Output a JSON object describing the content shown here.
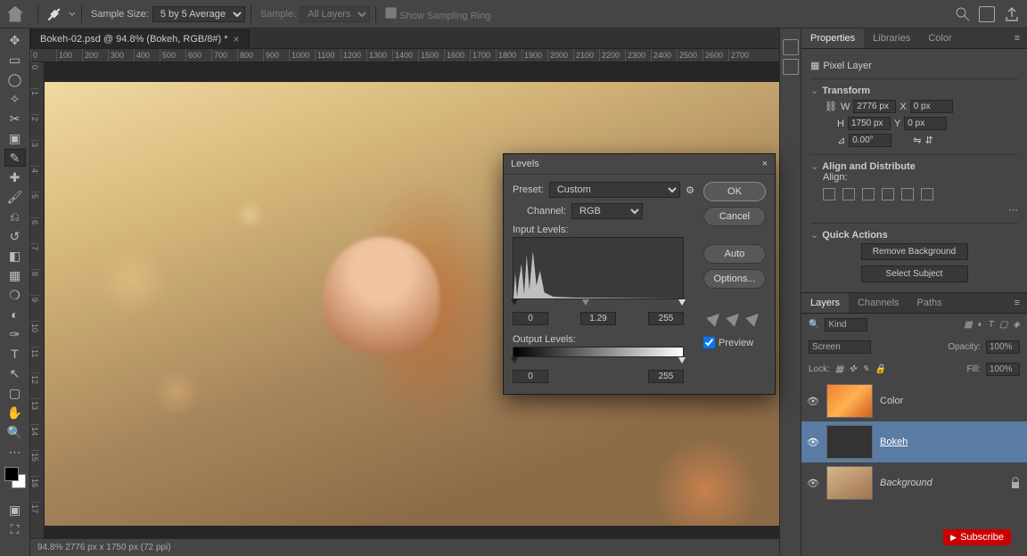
{
  "topbar": {
    "sample_size_label": "Sample Size:",
    "sample_size_value": "5 by 5 Average",
    "sample_label": "Sample:",
    "sample_value": "All Layers",
    "show_ring": "Show Sampling Ring"
  },
  "document": {
    "tab_title": "Bokeh-02.psd @ 94.8% (Bokeh, RGB/8#) *"
  },
  "ruler_marks": [
    "0",
    "100",
    "200",
    "300",
    "400",
    "500",
    "600",
    "700",
    "800",
    "900",
    "1000",
    "1100",
    "1200",
    "1300",
    "1400",
    "1500",
    "1600",
    "1700",
    "1800",
    "1900",
    "2000",
    "2100",
    "2200",
    "2300",
    "2400",
    "2500",
    "2600",
    "2700"
  ],
  "statusbar": "94.8%      2776 px x 1750 px (72 ppi)",
  "properties": {
    "tab_props": "Properties",
    "tab_libs": "Libraries",
    "tab_color": "Color",
    "layer_type": "Pixel Layer",
    "transform": "Transform",
    "w_label": "W",
    "w": "2776 px",
    "x_label": "X",
    "x": "0 px",
    "h_label": "H",
    "h": "1750 px",
    "y_label": "Y",
    "y": "0 px",
    "angle": "0.00°",
    "align": "Align and Distribute",
    "align_label": "Align:",
    "quick": "Quick Actions",
    "remove_bg": "Remove Background",
    "select_subj": "Select Subject"
  },
  "layers": {
    "tab_layers": "Layers",
    "tab_channels": "Channels",
    "tab_paths": "Paths",
    "search_ph": "Kind",
    "blend": "Screen",
    "opacity_label": "Opacity:",
    "opacity": "100%",
    "lock_label": "Lock:",
    "fill_label": "Fill:",
    "fill": "100%",
    "items": [
      {
        "name": "Color"
      },
      {
        "name": "Bokeh"
      },
      {
        "name": "Background"
      }
    ]
  },
  "dialog": {
    "title": "Levels",
    "preset_label": "Preset:",
    "preset": "Custom",
    "channel_label": "Channel:",
    "channel": "RGB",
    "input_label": "Input Levels:",
    "in_black": "0",
    "in_mid": "1.29",
    "in_white": "255",
    "output_label": "Output Levels:",
    "out_black": "0",
    "out_white": "255",
    "ok": "OK",
    "cancel": "Cancel",
    "auto": "Auto",
    "options": "Options...",
    "preview": "Preview"
  },
  "subscribe": "Subscribe"
}
